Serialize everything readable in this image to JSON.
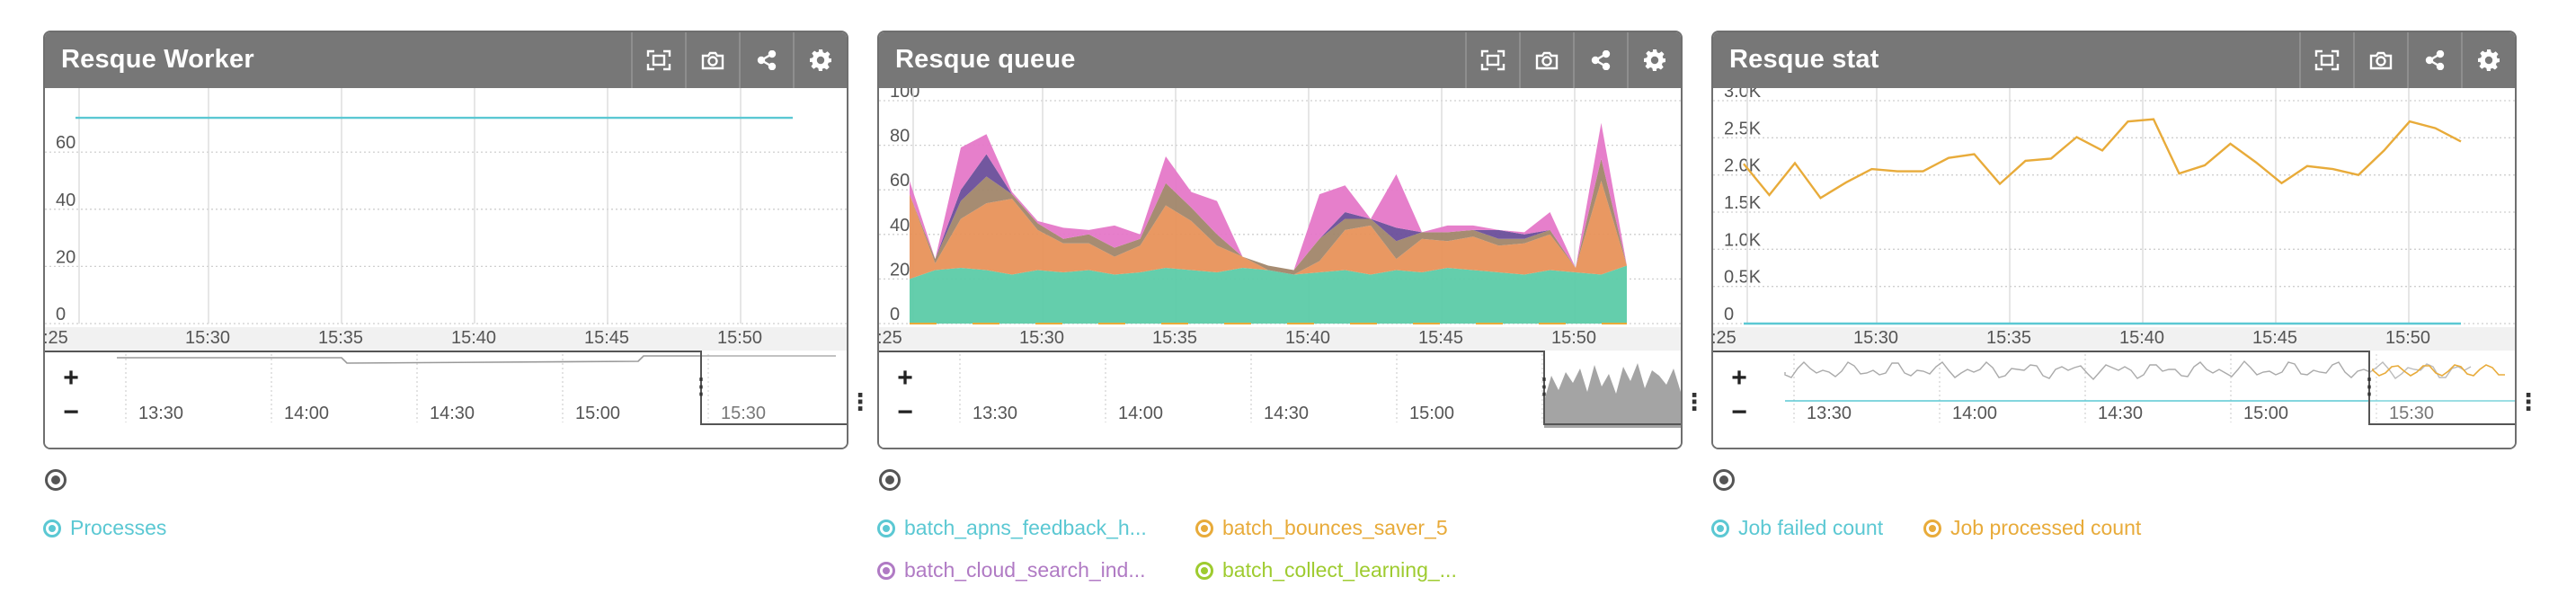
{
  "panels": [
    {
      "title": "Resque Worker",
      "tools": [
        "fullscreen-icon",
        "camera-icon",
        "share-icon",
        "gear-icon"
      ],
      "legend": [
        {
          "label": "Processes",
          "color": "#5bc8d3"
        }
      ]
    },
    {
      "title": "Resque queue",
      "tools": [
        "fullscreen-icon",
        "camera-icon",
        "share-icon",
        "gear-icon"
      ],
      "legend": [
        {
          "label": "batch_apns_feedback_h...",
          "color": "#5bc8d3"
        },
        {
          "label": "batch_bounces_saver_5",
          "color": "#e8ab3a"
        },
        {
          "label": "batch_cloud_search_ind...",
          "color": "#b07ac4"
        },
        {
          "label": "batch_collect_learning_...",
          "color": "#9ecb2f"
        }
      ]
    },
    {
      "title": "Resque stat",
      "tools": [
        "fullscreen-icon",
        "camera-icon",
        "share-icon",
        "gear-icon"
      ],
      "legend": [
        {
          "label": "Job failed count",
          "color": "#5bc8d3"
        },
        {
          "label": "Job processed count",
          "color": "#e8ab3a"
        }
      ]
    }
  ],
  "navigator": {
    "zoom_in": "+",
    "zoom_out": "−",
    "ticks": [
      "13:30",
      "14:00",
      "14:30",
      "15:00",
      "15:30"
    ]
  },
  "chart_data": [
    {
      "type": "line",
      "title": "Resque Worker",
      "x_ticks": [
        ":25",
        "15:30",
        "15:35",
        "15:40",
        "15:45",
        "15:50"
      ],
      "y_ticks": [
        "0",
        "20",
        "40",
        "60"
      ],
      "ylim": [
        0,
        78
      ],
      "x": [
        0,
        28
      ],
      "series": [
        {
          "name": "Processes",
          "color": "#5bc8d3",
          "values": [
            72,
            72
          ]
        }
      ],
      "grid": true
    },
    {
      "type": "area",
      "title": "Resque queue",
      "x_ticks": [
        ":25",
        "15:30",
        "15:35",
        "15:40",
        "15:45",
        "15:50"
      ],
      "y_ticks": [
        "0",
        "20",
        "40",
        "60",
        "80",
        "100"
      ],
      "ylim": [
        0,
        100
      ],
      "x": [
        0,
        1,
        2,
        3,
        4,
        5,
        6,
        7,
        8,
        9,
        10,
        11,
        12,
        13,
        14,
        15,
        16,
        17,
        18,
        19,
        20,
        21,
        22,
        23,
        24,
        25,
        26,
        27,
        28
      ],
      "stacked": true,
      "series": [
        {
          "name": "teal",
          "color": "#5ccba8",
          "values": [
            20,
            24,
            25,
            24,
            22,
            24,
            23,
            24,
            22,
            23,
            25,
            24,
            23,
            25,
            24,
            22,
            23,
            24,
            22,
            24,
            23,
            25,
            24,
            23,
            22,
            24,
            23,
            22,
            26
          ]
        },
        {
          "name": "orange",
          "color": "#e8925a",
          "values": [
            38,
            3,
            22,
            30,
            34,
            18,
            13,
            12,
            8,
            12,
            28,
            22,
            12,
            5,
            0,
            0,
            5,
            18,
            22,
            5,
            15,
            12,
            15,
            12,
            14,
            16,
            2,
            42,
            0
          ]
        },
        {
          "name": "brown",
          "color": "#a1866a",
          "values": [
            0,
            2,
            8,
            12,
            2,
            3,
            2,
            4,
            4,
            3,
            10,
            6,
            5,
            0,
            2,
            2,
            10,
            5,
            3,
            8,
            3,
            4,
            3,
            3,
            2,
            2,
            0,
            10,
            0
          ]
        },
        {
          "name": "purple",
          "color": "#6a4e9a",
          "values": [
            0,
            0,
            5,
            10,
            0,
            0,
            0,
            0,
            0,
            0,
            0,
            0,
            0,
            0,
            0,
            0,
            0,
            3,
            0,
            6,
            0,
            0,
            0,
            4,
            2,
            0,
            0,
            0,
            0
          ]
        },
        {
          "name": "pink",
          "color": "#e578c8",
          "values": [
            6,
            0,
            19,
            9,
            1,
            1,
            5,
            2,
            10,
            2,
            12,
            7,
            15,
            0,
            0,
            0,
            20,
            12,
            0,
            24,
            0,
            3,
            2,
            0,
            1,
            8,
            0,
            16,
            0
          ]
        }
      ],
      "grid": true
    },
    {
      "type": "line",
      "title": "Resque stat",
      "x_ticks": [
        ":25",
        "15:30",
        "15:35",
        "15:40",
        "15:45",
        "15:50"
      ],
      "y_ticks": [
        "0",
        "0.5K",
        "1.0K",
        "1.5K",
        "2.0K",
        "2.5K",
        "3.0K"
      ],
      "ylim": [
        0,
        3000
      ],
      "x": [
        0,
        1,
        2,
        3,
        4,
        5,
        6,
        7,
        8,
        9,
        10,
        11,
        12,
        13,
        14,
        15,
        16,
        17,
        18,
        19,
        20,
        21,
        22,
        23,
        24,
        25,
        26,
        27,
        28
      ],
      "series": [
        {
          "name": "Job failed count",
          "color": "#5bc8d3",
          "values": [
            0,
            0,
            0,
            0,
            0,
            0,
            0,
            0,
            0,
            0,
            0,
            0,
            0,
            0,
            0,
            0,
            0,
            0,
            0,
            0,
            0,
            0,
            0,
            0,
            0,
            0,
            0,
            0,
            0
          ]
        },
        {
          "name": "Job processed count",
          "color": "#e8ab3a",
          "values": [
            2150,
            1730,
            2160,
            1690,
            1900,
            2080,
            2050,
            2050,
            2230,
            2280,
            1880,
            2190,
            2220,
            2510,
            2330,
            2720,
            2750,
            2020,
            2130,
            2420,
            2170,
            1890,
            2120,
            2080,
            2000,
            2330,
            2720,
            2630,
            2450
          ]
        }
      ],
      "grid": true
    }
  ]
}
